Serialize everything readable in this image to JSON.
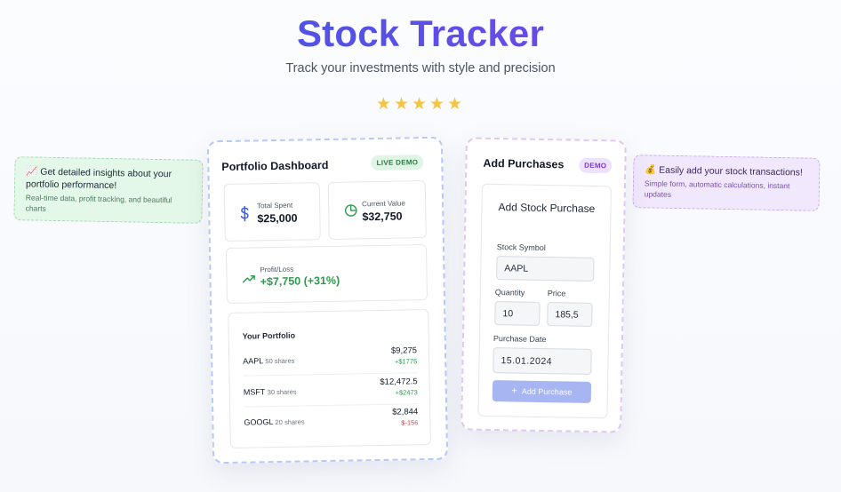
{
  "hero": {
    "title": "Stock Tracker",
    "subtitle": "Track your investments with style and precision",
    "stars": "★★★★★",
    "rating": 5
  },
  "callouts": {
    "left": {
      "title": "📈 Get detailed insights about your portfolio performance!",
      "description": "Real-time data, profit tracking, and beautiful charts"
    },
    "right": {
      "title": "💰 Easily add your stock transactions!",
      "description": "Simple form, automatic calculations, instant updates"
    }
  },
  "dashboard": {
    "title": "Portfolio Dashboard",
    "badge": "LIVE DEMO",
    "total_spent": {
      "label": "Total Spent",
      "value": "$25,000",
      "icon": "dollar-icon"
    },
    "current_value": {
      "label": "Current Value",
      "value": "$32,750",
      "icon": "pie-chart-icon"
    },
    "profit_loss": {
      "label": "Profit/Loss",
      "value": "+$7,750 (+31%)",
      "icon": "trending-up-icon"
    },
    "portfolio": {
      "heading": "Your Portfolio",
      "holdings": [
        {
          "symbol": "AAPL",
          "shares": "50 shares",
          "value": "$9,275",
          "change": "+$1775"
        },
        {
          "symbol": "MSFT",
          "shares": "30 shares",
          "value": "$12,472.5",
          "change": "+$2473"
        },
        {
          "symbol": "GOOGL",
          "shares": "20 shares",
          "value": "$2,844",
          "change": "$-156"
        }
      ]
    }
  },
  "purchases": {
    "title": "Add Purchases",
    "badge": "DEMO",
    "form": {
      "title": "Add Stock Purchase",
      "symbol_label": "Stock Symbol",
      "symbol_value": "AAPL",
      "quantity_label": "Quantity",
      "quantity_value": "10",
      "price_label": "Price",
      "price_value": "185,5",
      "date_label": "Purchase Date",
      "date_value": "15.01.2024",
      "submit_label": "Add Purchase"
    }
  },
  "colors": {
    "accent": "#3b5be0",
    "accent_purple": "#8a3df0",
    "positive": "#2f9a4e",
    "negative": "#d64545",
    "star": "#f5c542"
  }
}
